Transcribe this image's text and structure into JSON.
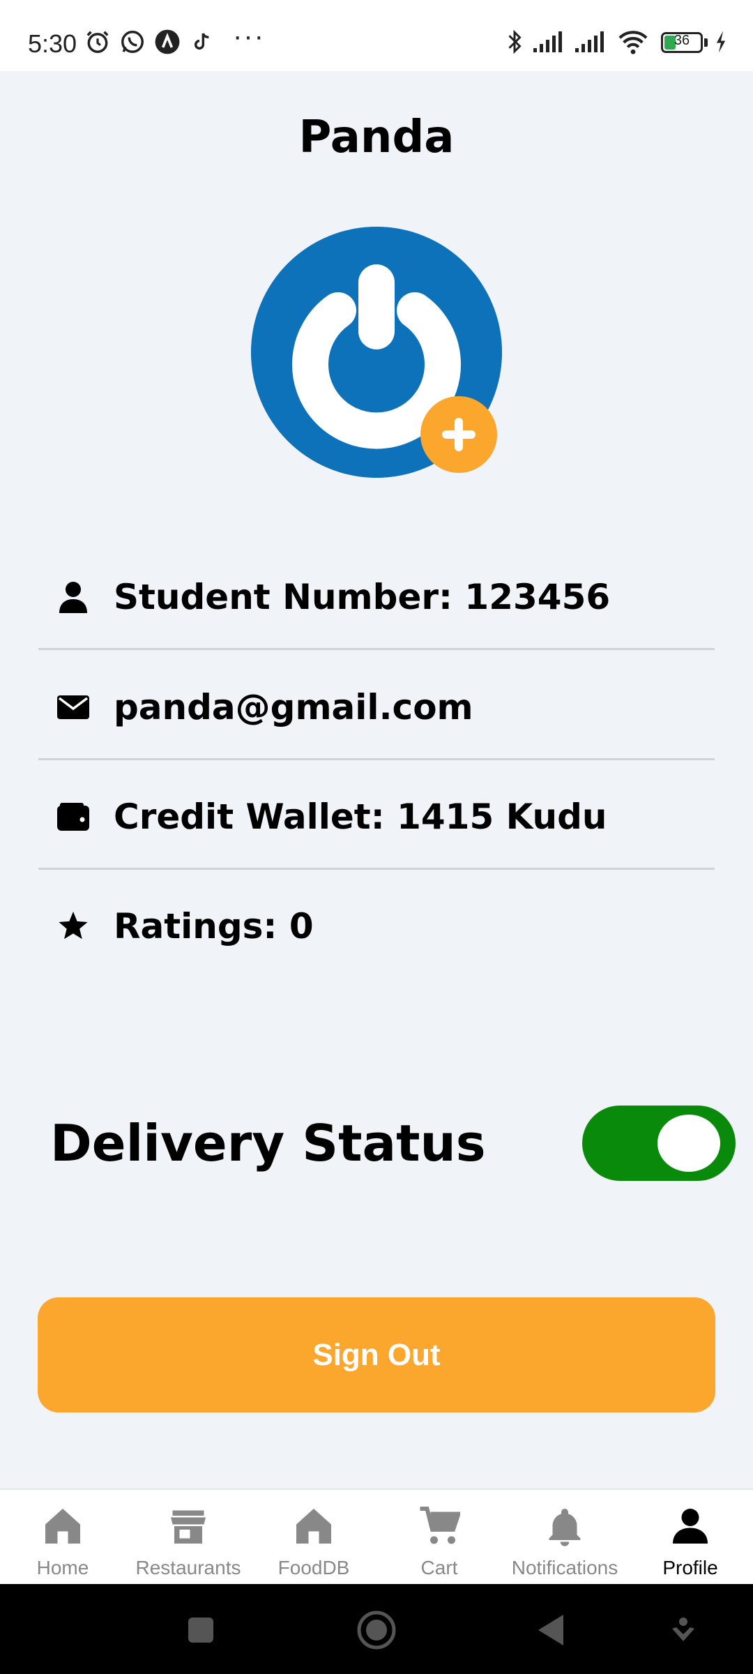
{
  "status_bar": {
    "time": "5:30",
    "battery_level": "36",
    "more_indicator": "···"
  },
  "page": {
    "title": "Panda"
  },
  "profile": {
    "avatar_icon": "power-logo",
    "add_photo_icon": "plus-icon",
    "info_rows": [
      {
        "icon": "person-icon",
        "text": "Student Number: 123456"
      },
      {
        "icon": "mail-icon",
        "text": "panda@gmail.com"
      },
      {
        "icon": "wallet-icon",
        "text": "Credit Wallet: 1415 Kudu"
      },
      {
        "icon": "star-icon",
        "text": "Ratings: 0"
      }
    ]
  },
  "delivery": {
    "label": "Delivery Status",
    "enabled": true,
    "toggle_color": "#0a8a0a"
  },
  "actions": {
    "sign_out_label": "Sign Out",
    "sign_out_color": "#fba62c"
  },
  "bottom_nav": {
    "items": [
      {
        "label": "Home",
        "icon": "home-icon",
        "active": false
      },
      {
        "label": "Restaurants",
        "icon": "store-icon",
        "active": false
      },
      {
        "label": "FoodDB",
        "icon": "home-icon",
        "active": false
      },
      {
        "label": "Cart",
        "icon": "cart-icon",
        "active": false
      },
      {
        "label": "Notifications",
        "icon": "bell-icon",
        "active": false
      },
      {
        "label": "Profile",
        "icon": "person-icon",
        "active": true
      }
    ]
  }
}
